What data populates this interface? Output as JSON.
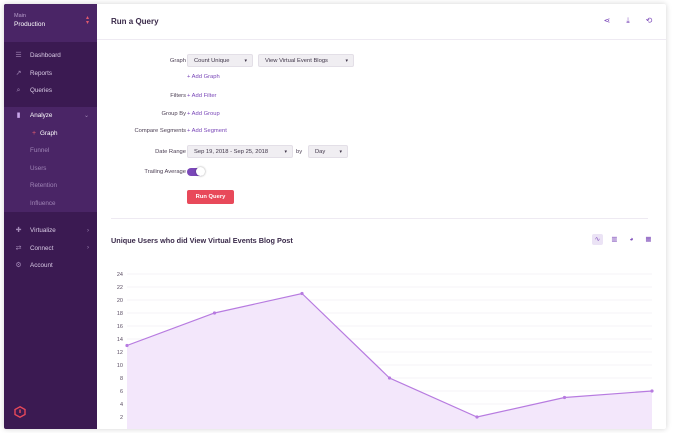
{
  "sidebar": {
    "env_label": "Main",
    "env_name": "Production",
    "items_top": [
      {
        "label": "Dashboard",
        "icon": "dashboard-icon"
      },
      {
        "label": "Reports",
        "icon": "reports-icon"
      },
      {
        "label": "Queries",
        "icon": "search-icon"
      }
    ],
    "analyze": {
      "label": "Analyze",
      "icon": "bar-chart-icon"
    },
    "analyze_sub": [
      "Graph",
      "Funnel",
      "Users",
      "Retention",
      "Influence"
    ],
    "items_bottom": [
      {
        "label": "Virtualize",
        "icon": "virtualize-icon"
      },
      {
        "label": "Connect",
        "icon": "connect-icon"
      },
      {
        "label": "Account",
        "icon": "gear-icon"
      }
    ]
  },
  "header": {
    "title": "Run a Query"
  },
  "form": {
    "graph_label": "Graph",
    "graph_type": "Count Unique",
    "graph_event": "View Virtual Event Blogs",
    "add_graph": "+ Add Graph",
    "filters_label": "Filters",
    "add_filter": "+ Add Filter",
    "group_label": "Group By",
    "add_group": "+ Add Group",
    "compare_label": "Compare Segments",
    "add_segment": "+ Add Segment",
    "date_label": "Date Range",
    "date_range": "Sep 19, 2018 - Sep 25, 2018",
    "by_label": "by",
    "interval": "Day",
    "trailing_label": "Trailing Average",
    "trailing_on": true,
    "run_button": "Run Query"
  },
  "chart_panel": {
    "title": "Unique Users who did View Virtual Events Blog Post"
  },
  "colors": {
    "accent": "#7a47b8",
    "run": "#e8495a",
    "sidebar": "#3b1a52",
    "line": "#b77be0",
    "fill": "#f3e7fb"
  },
  "chart_data": {
    "type": "area",
    "title": "Unique Users who did View Virtual Events Blog Post",
    "x": [
      1,
      2,
      3,
      4,
      5,
      6,
      7
    ],
    "series": [
      {
        "values": [
          13,
          18,
          21,
          8,
          2,
          5,
          6
        ]
      }
    ],
    "ylim": [
      0,
      24
    ],
    "yticks": [
      2,
      4,
      6,
      8,
      10,
      12,
      14,
      16,
      18,
      20,
      22,
      24
    ],
    "grid": true
  }
}
